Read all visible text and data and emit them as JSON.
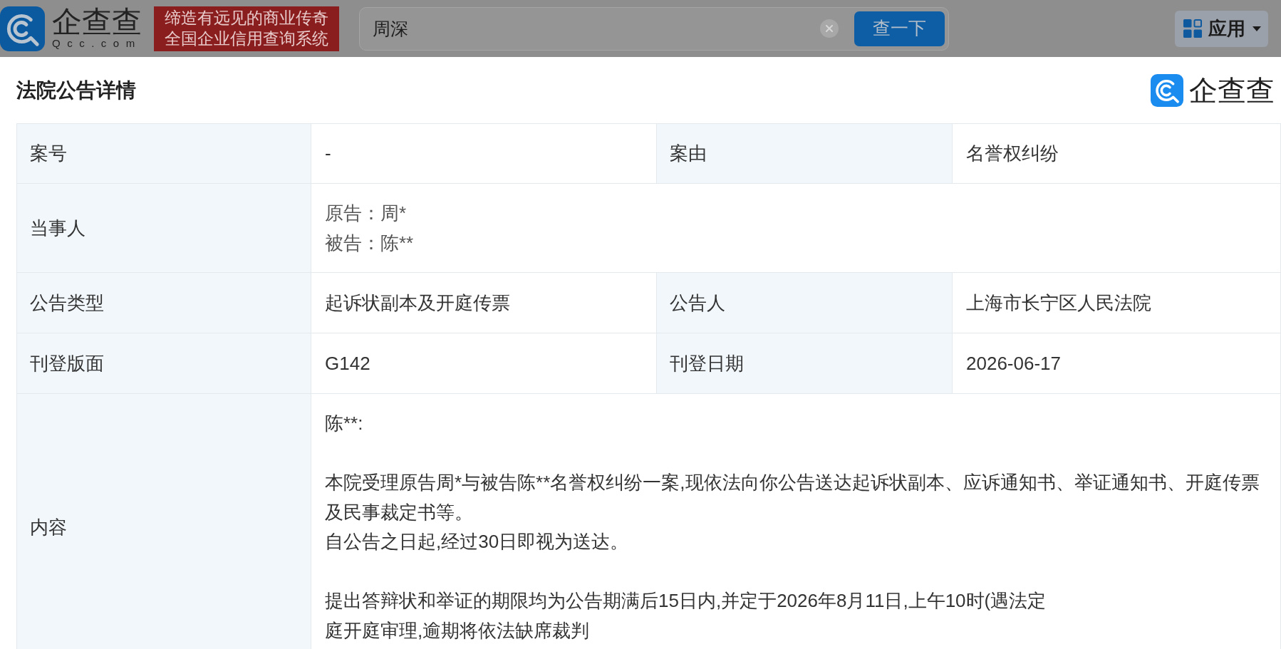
{
  "header": {
    "logo": {
      "name": "企查查",
      "domain": "Qcc.com"
    },
    "slogan": [
      "缔造有远见的商业传奇",
      "全国企业信用查询系统"
    ],
    "search": {
      "value": "周深",
      "button": "查一下"
    },
    "apps_button": "应用"
  },
  "dialog": {
    "title": "法院公告详情",
    "brand": "企查查"
  },
  "details": {
    "rows": [
      {
        "kind": "pair",
        "fields": [
          {
            "label": "案号",
            "value": "-"
          },
          {
            "label": "案由",
            "value": "名誉权纠纷"
          }
        ]
      },
      {
        "kind": "parties",
        "label": "当事人",
        "lines": [
          "原告：周*",
          "被告：陈**"
        ]
      },
      {
        "kind": "pair",
        "fields": [
          {
            "label": "公告类型",
            "value": "起诉状副本及开庭传票"
          },
          {
            "label": "公告人",
            "value": "上海市长宁区人民法院"
          }
        ]
      },
      {
        "kind": "pair",
        "fields": [
          {
            "label": "刊登版面",
            "value": "G142"
          },
          {
            "label": "刊登日期",
            "value": "2026-06-17"
          }
        ]
      },
      {
        "kind": "content",
        "label": "内容",
        "paragraphs": [
          [
            "陈**:"
          ],
          [
            "本院受理原告周*与被告陈**名誉权纠纷一案,现依法向你公告送达起诉状副本、应诉通知书、举证通知书、开庭传票",
            "及民事裁定书等。",
            "自公告之日起,经过30日即视为送达。"
          ],
          [
            "提出答辩状和举证的期限均为公告期满后15日内,并定于2026年8月11日,上午10时(遇法定",
            "庭开庭审理,逾期将依法缺席裁判"
          ]
        ]
      }
    ]
  }
}
